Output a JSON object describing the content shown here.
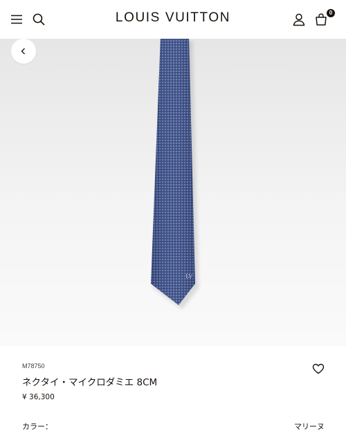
{
  "header": {
    "brand": "LOUIS VUITTON",
    "bag_count": "0",
    "icons": {
      "menu": "menu-icon",
      "search": "search-icon",
      "account": "user-icon",
      "bag": "shopping-bag-icon"
    }
  },
  "hero": {
    "back_icon": "chevron-left-icon",
    "product_image": "navy-micro-damier-necktie"
  },
  "product": {
    "sku": "M78750",
    "name": "ネクタイ・マイクロダミエ 8CM",
    "price": "¥ 36,300",
    "wishlist_icon": "heart-icon",
    "color_label": "カラー：",
    "color_value": "マリーヌ"
  },
  "colors": {
    "text": "#19110b",
    "tie": "#3e5189",
    "tie_pattern": "#8fa0cf"
  }
}
